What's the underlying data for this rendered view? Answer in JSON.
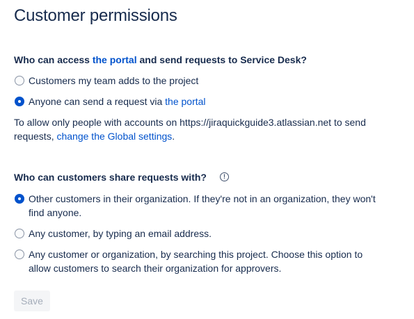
{
  "header": {
    "title": "Customer permissions"
  },
  "access_section": {
    "title_prefix": "Who can access ",
    "title_link": "the portal",
    "title_suffix": " and send requests to Service Desk?",
    "options": [
      {
        "label": "Customers my team adds to the project",
        "selected": false
      },
      {
        "label_prefix": "Anyone can send a request via ",
        "label_link": "the portal",
        "selected": true
      }
    ],
    "note_line1": "To allow only people with accounts on https://jiraquickguide3.atlassian.net to send",
    "note_line2_prefix": "requests, ",
    "note_link": "change the Global settings",
    "note_suffix": "."
  },
  "share_section": {
    "title": "Who can customers share requests with?",
    "info_icon": "info-circle-icon",
    "options": [
      {
        "line1": "Other customers in their organization. If they're not in an organization, they won't",
        "line2": "find anyone.",
        "selected": true
      },
      {
        "line1": "Any customer, by typing an email address.",
        "selected": false
      },
      {
        "line1": "Any customer or organization, by searching this project. Choose this option to",
        "line2": "allow customers to search their organization for approvers.",
        "selected": false
      }
    ]
  },
  "footer": {
    "save_label": "Save",
    "save_disabled": true
  },
  "colors": {
    "link": "#0052cc",
    "text": "#172b4d",
    "radio_selected": "#0052cc"
  }
}
